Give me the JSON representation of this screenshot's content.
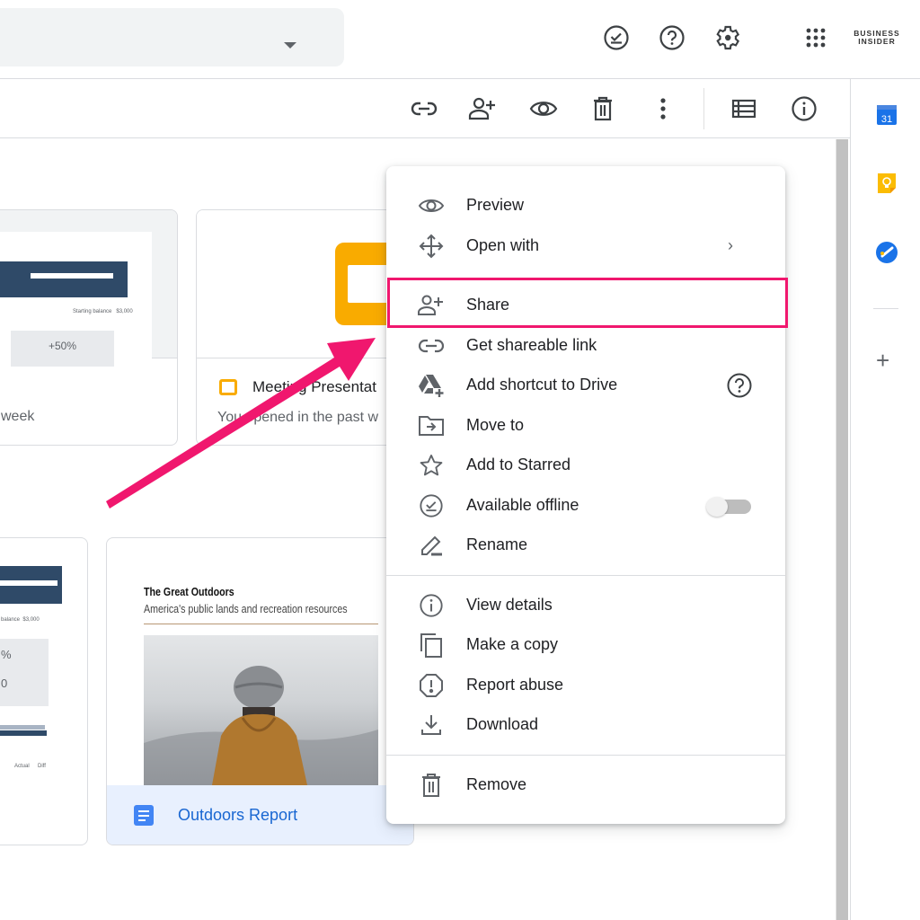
{
  "header": {
    "search_dropdown_icon": "caret-down-icon",
    "icons": [
      {
        "name": "offline-ready-icon",
        "label": "Ready for offline"
      },
      {
        "name": "help-icon",
        "label": "Support"
      },
      {
        "name": "settings-icon",
        "label": "Settings"
      },
      {
        "name": "apps-grid-icon",
        "label": "Google apps"
      }
    ],
    "watermark_line1": "BUSINESS",
    "watermark_line2": "INSIDER"
  },
  "toolbar": {
    "icons": [
      {
        "name": "get-link-icon",
        "label": "Get shareable link"
      },
      {
        "name": "share-icon",
        "label": "Share"
      },
      {
        "name": "preview-icon",
        "label": "Preview"
      },
      {
        "name": "trash-icon",
        "label": "Remove"
      },
      {
        "name": "more-actions-icon",
        "label": "More actions"
      },
      {
        "name": "list-view-icon",
        "label": "List layout"
      },
      {
        "name": "details-icon",
        "label": "View details"
      }
    ]
  },
  "side_panel": {
    "apps": [
      {
        "name": "calendar-app-icon",
        "label": "31",
        "color": "#1a73e8"
      },
      {
        "name": "keep-app-icon",
        "color": "#fbbc04"
      },
      {
        "name": "tasks-app-icon",
        "color": "#1a73e8"
      }
    ],
    "add_label": "+"
  },
  "files": {
    "suggested": [
      {
        "title": "",
        "subtitle": "week",
        "thumb_note": "+50%"
      },
      {
        "title": "Meeting Presentat",
        "subtitle": "You opened in the past w",
        "type": "slides",
        "color": "#f9ab00"
      }
    ],
    "grid": [
      {
        "title": "",
        "thumb_labels": [
          "%",
          "0",
          "Actual",
          "Diff"
        ]
      },
      {
        "title": "Outdoors Report",
        "type": "docs",
        "color": "#4285f4",
        "selected": true,
        "thumb_heading": "The Great Outdoors",
        "thumb_subheading": "America's public lands and recreation resources"
      }
    ]
  },
  "context_menu": {
    "items": [
      {
        "label": "Preview",
        "icon": "eye-icon"
      },
      {
        "label": "Open with",
        "icon": "open-with-icon",
        "submenu": true
      },
      {
        "label": "Share",
        "icon": "person-add-icon",
        "highlighted": true
      },
      {
        "label": "Get shareable link",
        "icon": "link-icon"
      },
      {
        "label": "Add shortcut to Drive",
        "icon": "drive-shortcut-icon",
        "help": true
      },
      {
        "label": "Move to",
        "icon": "move-folder-icon"
      },
      {
        "label": "Add to Starred",
        "icon": "star-icon"
      },
      {
        "label": "Available offline",
        "icon": "offline-check-icon",
        "toggle": false
      },
      {
        "label": "Rename",
        "icon": "pencil-icon"
      },
      {
        "label": "View details",
        "icon": "info-icon"
      },
      {
        "label": "Make a copy",
        "icon": "copy-icon"
      },
      {
        "label": "Report abuse",
        "icon": "report-icon"
      },
      {
        "label": "Download",
        "icon": "download-icon"
      },
      {
        "label": "Remove",
        "icon": "trash-icon"
      }
    ],
    "submenu_glyph": "›",
    "highlight_color": "#f0176e"
  },
  "annotation": {
    "arrow_color": "#f0176e",
    "target": "Share"
  }
}
